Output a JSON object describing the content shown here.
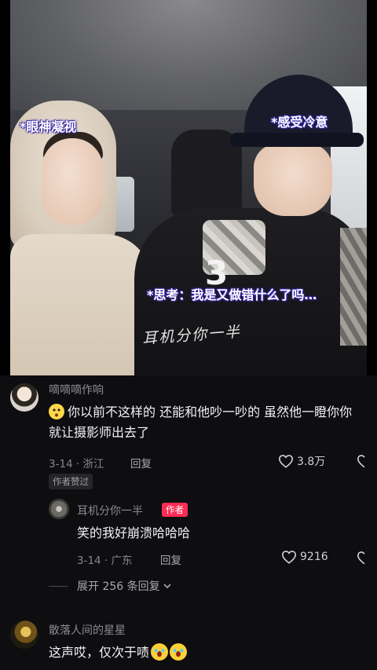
{
  "video": {
    "caption_left": "*眼神凝视",
    "caption_right": "*感受冷意",
    "caption_middle": "*思考：我是又做错什么了吗…",
    "watermark": "耳机分你一半",
    "jersey_number": "3"
  },
  "comments": [
    {
      "username": "嘀嘀嘀作响",
      "text": "你以前不这样的 还能和他吵一吵的 虽然他一瞪你你就让摄影师出去了",
      "date": "3-14",
      "location": "浙江",
      "reply_label": "回复",
      "likes": "3.8万",
      "author_liked_badge": "作者赞过",
      "replies": [
        {
          "username": "耳机分你一半",
          "author_badge": "作者",
          "text": "笑的我好崩溃哈哈哈",
          "date": "3-14",
          "location": "广东",
          "reply_label": "回复",
          "likes": "9216"
        }
      ],
      "expand_label": "展开 256 条回复"
    },
    {
      "username": "散落人间的星星",
      "text": "这声哎，仅次于啧"
    }
  ],
  "icons": {
    "heart": "heart-outline-icon",
    "chevron": "chevron-down-icon",
    "emoji_first": "eye-roll-emoji",
    "emoji_laugh": "rolling-laugh-emoji"
  }
}
